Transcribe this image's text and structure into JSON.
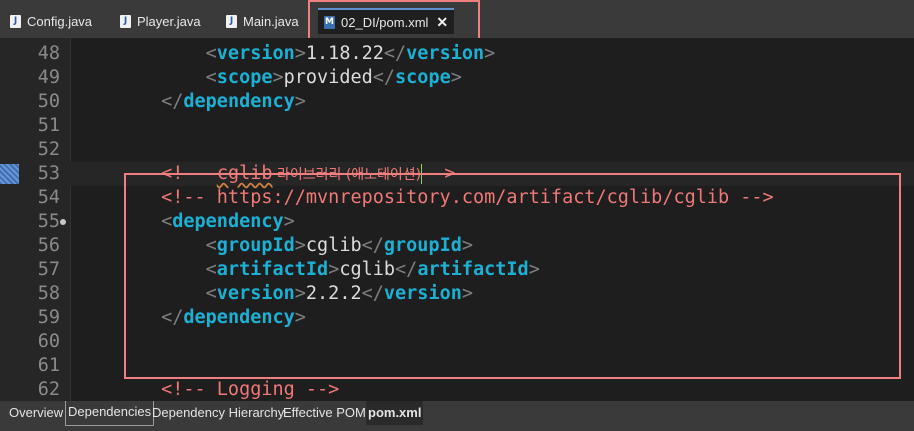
{
  "tabs": [
    {
      "label": "Config.java",
      "icon": "java-file-icon"
    },
    {
      "label": "Player.java",
      "icon": "java-file-icon"
    },
    {
      "label": "Main.java",
      "icon": "java-file-icon"
    },
    {
      "label": "02_DI/pom.xml",
      "icon": "maven-pom-icon",
      "active": true,
      "close": "✕"
    }
  ],
  "icon_letters": {
    "java": "J",
    "maven": "M"
  },
  "editor": {
    "lines": [
      {
        "num": "48",
        "indent": "            ",
        "open": "version",
        "text": "1.18.22",
        "close": "version"
      },
      {
        "num": "49",
        "indent": "            ",
        "open": "scope",
        "text": "provided",
        "close": "scope"
      },
      {
        "num": "50",
        "indent": "        ",
        "endtag": "dependency"
      },
      {
        "num": "51"
      },
      {
        "num": "52"
      },
      {
        "num": "53",
        "indent": "        ",
        "comment_start": "<!-- ",
        "comment_word": "cglib",
        "comment_kor": " 라이브러리 (애노테이션)",
        "comment_end": "-->"
      },
      {
        "num": "54",
        "indent": "        ",
        "comment": "<!-- https://mvnrepository.com/artifact/cglib/cglib -->"
      },
      {
        "num": "55",
        "indent": "        ",
        "starttag": "dependency",
        "fold": true
      },
      {
        "num": "56",
        "indent": "            ",
        "open": "groupId",
        "text": "cglib",
        "close": "groupId"
      },
      {
        "num": "57",
        "indent": "            ",
        "open": "artifactId",
        "text": "cglib",
        "close": "artifactId"
      },
      {
        "num": "58",
        "indent": "            ",
        "open": "version",
        "text": "2.2.2",
        "close": "version"
      },
      {
        "num": "59",
        "indent": "        ",
        "endtag": "dependency"
      },
      {
        "num": "60"
      },
      {
        "num": "61"
      },
      {
        "num": "62",
        "indent": "        ",
        "comment": "<!-- Logging -->"
      }
    ]
  },
  "bottom_tabs": [
    {
      "label": "Overview"
    },
    {
      "label": "Dependencies"
    },
    {
      "label": "Dependency Hierarchy"
    },
    {
      "label": "Effective POM"
    },
    {
      "label": "pom.xml",
      "active": true
    }
  ],
  "colors": {
    "tag": "#1cb0d4",
    "comment": "#f07878",
    "highlight": "#f08080",
    "text": "#dcdcdc"
  }
}
